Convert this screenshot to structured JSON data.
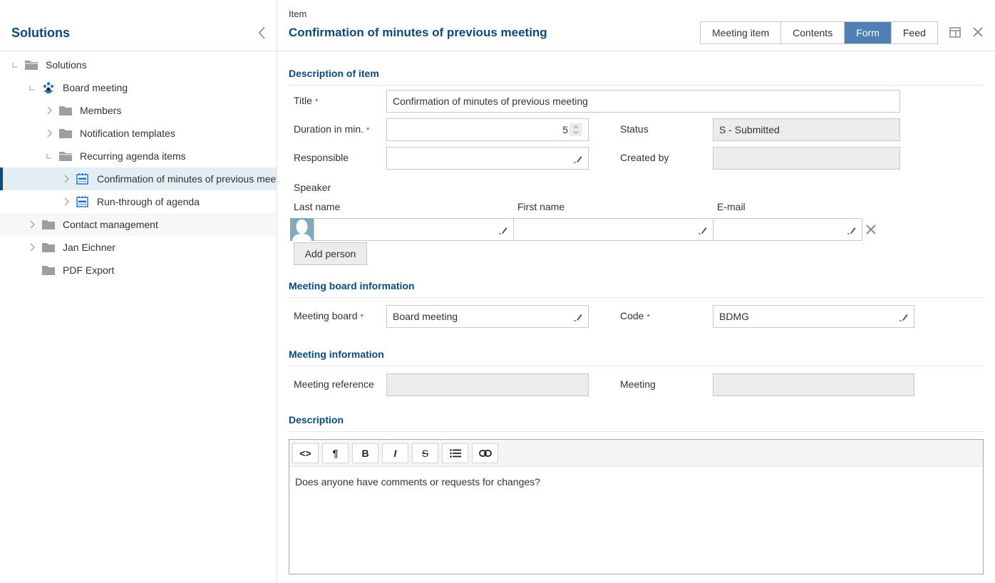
{
  "sidebar": {
    "title": "Solutions",
    "collapse_icon": "chevron-left-icon",
    "tree": [
      {
        "label": "Solutions",
        "level": 0,
        "toggle": "expanded",
        "icon": "folder-open-icon"
      },
      {
        "label": "Board meeting",
        "level": 1,
        "toggle": "expanded",
        "icon": "board-meeting-icon"
      },
      {
        "label": "Members",
        "level": 2,
        "toggle": "collapsed",
        "icon": "folder-icon"
      },
      {
        "label": "Notification templates",
        "level": 2,
        "toggle": "collapsed",
        "icon": "folder-icon"
      },
      {
        "label": "Recurring agenda items",
        "level": 2,
        "toggle": "expanded",
        "icon": "folder-open-icon"
      },
      {
        "label": "Confirmation of minutes of previous meeting",
        "level": 3,
        "toggle": "collapsed",
        "icon": "agenda-item-icon",
        "selected": true
      },
      {
        "label": "Run-through of agenda",
        "level": 3,
        "toggle": "collapsed",
        "icon": "agenda-item-icon"
      },
      {
        "label": "Contact management",
        "level": 1,
        "toggle": "collapsed",
        "icon": "folder-icon"
      },
      {
        "label": "Jan Eichner",
        "level": 1,
        "toggle": "collapsed",
        "icon": "folder-icon"
      },
      {
        "label": "PDF Export",
        "level": 1,
        "toggle": "none",
        "icon": "folder-icon"
      }
    ]
  },
  "header": {
    "subtitle": "Item",
    "title": "Confirmation of minutes of previous meeting",
    "tabs": [
      {
        "label": "Meeting item",
        "active": false
      },
      {
        "label": "Contents",
        "active": false
      },
      {
        "label": "Form",
        "active": true
      },
      {
        "label": "Feed",
        "active": false
      }
    ]
  },
  "form": {
    "sections": {
      "description_of_item": "Description of item",
      "meeting_board_information": "Meeting board information",
      "meeting_information": "Meeting information",
      "description": "Description"
    },
    "title": {
      "label": "Title",
      "value": "Confirmation of minutes of previous meeting",
      "required": true
    },
    "duration": {
      "label": "Duration in min.",
      "value": "5",
      "required": true
    },
    "responsible": {
      "label": "Responsible",
      "value": ""
    },
    "status": {
      "label": "Status",
      "value": "S - Submitted"
    },
    "created_by": {
      "label": "Created by",
      "value": ""
    },
    "speaker": {
      "label": "Speaker",
      "columns": [
        "Last name",
        "First name",
        "E-mail"
      ],
      "rows": [
        {
          "last_name": "",
          "first_name": "",
          "email": ""
        }
      ],
      "add_label": "Add person"
    },
    "meeting_board": {
      "label": "Meeting board",
      "value": "Board meeting",
      "required": true
    },
    "code": {
      "label": "Code",
      "value": "BDMG",
      "required": true
    },
    "meeting_reference": {
      "label": "Meeting reference",
      "value": ""
    },
    "meeting": {
      "label": "Meeting",
      "value": ""
    },
    "editor": {
      "toolbar": [
        {
          "name": "source-code",
          "glyph": "<>"
        },
        {
          "name": "paragraph",
          "glyph": "¶"
        },
        {
          "name": "bold",
          "glyph": "B"
        },
        {
          "name": "italic",
          "glyph": "I"
        },
        {
          "name": "strikethrough",
          "glyph": "S"
        },
        {
          "name": "bullet-list",
          "glyph": "☰"
        },
        {
          "name": "link",
          "glyph": "⊂⊃"
        }
      ],
      "content": "Does anyone have comments or requests for changes?"
    },
    "required_marker": "*"
  },
  "colors": {
    "accent": "#0b4a7c",
    "active_tab": "#4f7fb5",
    "required": "#bb2222"
  }
}
